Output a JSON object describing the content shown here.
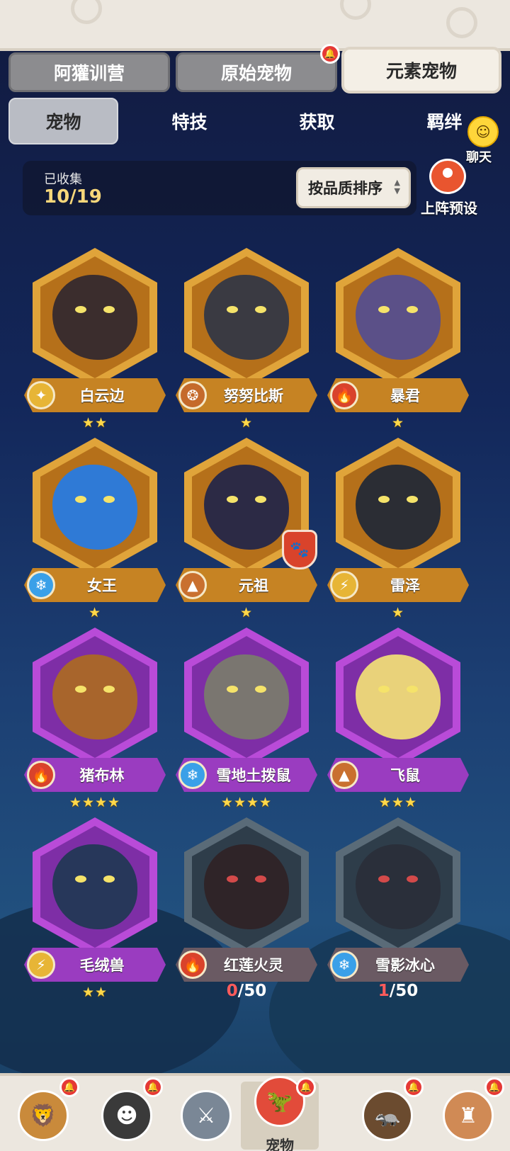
{
  "tabs": [
    {
      "label": "阿獾训营",
      "active": false,
      "has_badge": false
    },
    {
      "label": "原始宠物",
      "active": false,
      "has_badge": true
    },
    {
      "label": "元素宠物",
      "active": true,
      "has_badge": false
    }
  ],
  "subtabs": [
    {
      "label": "宠物",
      "active": true
    },
    {
      "label": "特技",
      "active": false
    },
    {
      "label": "获取",
      "active": false
    },
    {
      "label": "羁绊",
      "active": false
    }
  ],
  "chat": {
    "label": "聊天"
  },
  "collection": {
    "caption": "已收集",
    "count": "10/19"
  },
  "sort_button": {
    "label": "按品质排序"
  },
  "preset_button": {
    "label": "上阵预设"
  },
  "pets": [
    {
      "name": "白云边",
      "element": "light",
      "element_icon": "sparkle-icon",
      "frame": "gold",
      "stars": 2,
      "color": "#3b2d2d"
    },
    {
      "name": "努努比斯",
      "element": "beast",
      "element_icon": "paw-ring-icon",
      "frame": "gold",
      "stars": 1,
      "color": "#3a3a42"
    },
    {
      "name": "暴君",
      "element": "fire",
      "element_icon": "flame-icon",
      "frame": "gold",
      "stars": 1,
      "color": "#5b5088"
    },
    {
      "name": "女王",
      "element": "ice",
      "element_icon": "snowflake-icon",
      "frame": "gold",
      "stars": 1,
      "color": "#2f7ad6"
    },
    {
      "name": "元祖",
      "element": "earth",
      "element_icon": "mountain-icon",
      "frame": "gold",
      "stars": 1,
      "color": "#2c2a45",
      "special_badge": "paw-shield-icon"
    },
    {
      "name": "雷泽",
      "element": "thunder",
      "element_icon": "lightning-icon",
      "frame": "gold",
      "stars": 1,
      "color": "#2b2d34"
    },
    {
      "name": "猪布林",
      "element": "fire",
      "element_icon": "flame-icon",
      "frame": "purple",
      "stars": 4,
      "color": "#a8652c"
    },
    {
      "name": "雪地土拨鼠",
      "element": "ice",
      "element_icon": "snowflake-icon",
      "frame": "purple",
      "stars": 4,
      "color": "#7a7670"
    },
    {
      "name": "飞鼠",
      "element": "earth",
      "element_icon": "mountain-icon",
      "frame": "purple",
      "stars": 3,
      "color": "#e9d27a"
    },
    {
      "name": "毛绒兽",
      "element": "thunder",
      "element_icon": "lightning-icon",
      "frame": "purple",
      "stars": 2,
      "color": "#27375a"
    },
    {
      "name": "红莲火灵",
      "element": "fire",
      "element_icon": "flame-icon",
      "frame": "gray",
      "fragments_have": "0",
      "fragments_need": "/50",
      "color": "#2f2428"
    },
    {
      "name": "雪影冰心",
      "element": "ice",
      "element_icon": "snowflake-icon",
      "frame": "gray",
      "fragments_have": "1",
      "fragments_need": "/50",
      "color": "#2a2f3a"
    }
  ],
  "bottom_nav": [
    {
      "name": "nav-lion-warrior",
      "icon": "lion-warrior-avatar-icon",
      "label": "",
      "active": false,
      "has_badge": true,
      "color": "#c98a3b"
    },
    {
      "name": "nav-hero",
      "icon": "hero-avatar-icon",
      "label": "",
      "active": false,
      "has_badge": true,
      "color": "#3a3a3a"
    },
    {
      "name": "nav-equipment",
      "icon": "sword-shield-icon",
      "label": "",
      "active": false,
      "has_badge": false,
      "color": "#7a8796"
    },
    {
      "name": "nav-pets",
      "icon": "pet-dino-icon",
      "label": "宠物",
      "active": true,
      "has_badge": true,
      "color": "#e24b3a"
    },
    {
      "name": "nav-badger",
      "icon": "badger-avatar-icon",
      "label": "",
      "active": false,
      "has_badge": true,
      "color": "#6b4b2f"
    },
    {
      "name": "nav-totem",
      "icon": "totem-avatar-icon",
      "label": "",
      "active": false,
      "has_badge": true,
      "color": "#d08a55"
    }
  ],
  "element_colors": {
    "light": "#e7b536",
    "beast": "#c56a2b",
    "fire": "#d9432b",
    "ice": "#3aa0e8",
    "earth": "#c9702f",
    "thunder": "#e7b536"
  },
  "star_glyph": "★"
}
